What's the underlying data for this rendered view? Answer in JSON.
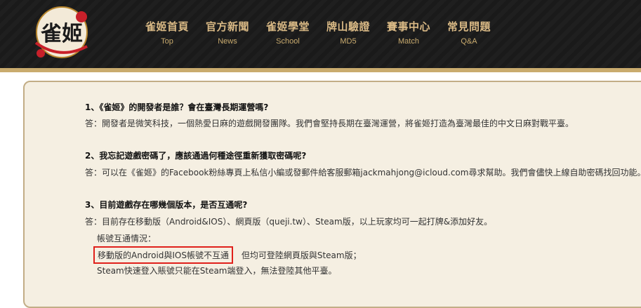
{
  "nav": {
    "items": [
      {
        "zh": "雀姬首頁",
        "en": "Top"
      },
      {
        "zh": "官方新聞",
        "en": "News"
      },
      {
        "zh": "雀姬學堂",
        "en": "School"
      },
      {
        "zh": "牌山驗證",
        "en": "MD5"
      },
      {
        "zh": "賽事中心",
        "en": "Match"
      },
      {
        "zh": "常見問題",
        "en": "Q&A"
      }
    ]
  },
  "logo": {
    "text": "雀姬"
  },
  "faq": [
    {
      "q": "1、《雀姬》的開發者是誰？會在臺灣長期運營嗎?",
      "a": "答：開發者是微笑科技，一個熱愛日麻的遊戲開發團隊。我們會堅持長期在臺灣運營，將雀姬打造為臺灣最佳的中文日麻對戰平臺。"
    },
    {
      "q": "2、我忘記遊戲密碼了，應該通過何種途徑重新獲取密碼呢?",
      "a": "答：可以在《雀姬》的Facebook粉絲專頁上私信小編或發郵件給客服郵箱jackmahjong@icloud.com尋求幫助。我們會儘快上線自助密碼找回功能。"
    },
    {
      "q": "3、目前遊戲存在哪幾個版本，是否互通呢?",
      "a": "答：目前存在移動版（Android&IOS）、網頁版（queji.tw）、Steam版，以上玩家均可一起打牌&添加好友。",
      "sub1": "帳號互通情況：",
      "highlight": "移動版的Android與IOS帳號不互通",
      "sub2_rest": "但均可登陸網頁版與Steam版；",
      "sub3": "Steam快速登入賬號只能在Steam端登入，無法登陸其他平臺。"
    }
  ],
  "colors": {
    "header_bg": "#1a1a1a",
    "gold": "#c9ab6e",
    "panel_bg": "#f5efe2",
    "highlight_border": "#e0201b"
  }
}
